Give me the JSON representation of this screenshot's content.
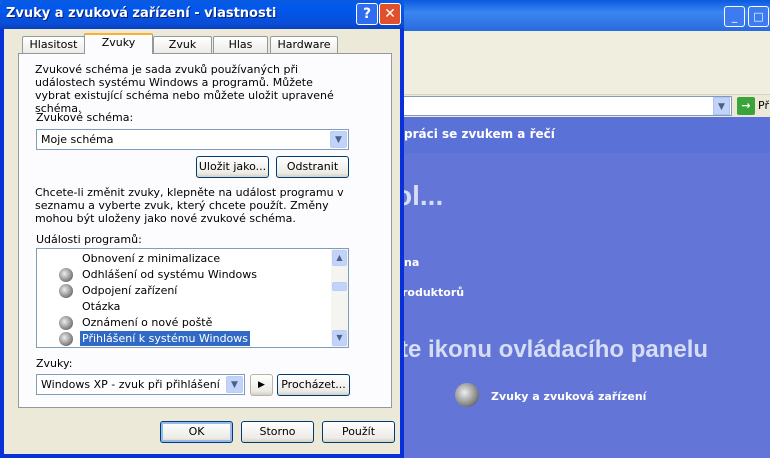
{
  "background_window": {
    "address_go_label": "Př",
    "header_text": "práci se zvukem a řečí",
    "heading_partial": "ol...",
    "link1_partial": "na",
    "link2_partial": "roduktorů",
    "pick_icon_heading": "te ikonu ovládacího panelu",
    "control_panel_icon_label": "Zvuky a zvuková zařízení"
  },
  "dialog": {
    "title": "Zvuky a zvuková zařízení - vlastnosti",
    "help_label": "?",
    "close_label": "✕",
    "tabs": [
      {
        "label": "Hlasitost"
      },
      {
        "label": "Zvuky",
        "selected": true
      },
      {
        "label": "Zvuk"
      },
      {
        "label": "Hlas"
      },
      {
        "label": "Hardware"
      }
    ],
    "scheme_description": "Zvukové schéma je sada zvuků používaných při událostech systému Windows a programů. Můžete vybrat existující schéma nebo můžete uložit upravené schéma.",
    "scheme_label": "Zvukové schéma:",
    "scheme_value": "Moje schéma",
    "save_as_label": "Uložit jako...",
    "delete_label": "Odstranit",
    "events_description": "Chcete-li změnit zvuky, klepněte na událost programu v seznamu a vyberte zvuk, který chcete použít. Změny mohou být uloženy jako nové zvukové schéma.",
    "events_label": "Události programů:",
    "events": [
      {
        "label": "Obnovení z minimalizace",
        "has_sound": false
      },
      {
        "label": "Odhlášení od systému Windows",
        "has_sound": true
      },
      {
        "label": "Odpojení zařízení",
        "has_sound": true
      },
      {
        "label": "Otázka",
        "has_sound": false
      },
      {
        "label": "Oznámení o nové poště",
        "has_sound": true
      },
      {
        "label": "Přihlášení k systému Windows",
        "has_sound": true,
        "selected": true
      }
    ],
    "sounds_label": "Zvuky:",
    "sound_value": "Windows XP - zvuk při přihlášení",
    "browse_label": "Procházet...",
    "ok_label": "OK",
    "cancel_label": "Storno",
    "apply_label": "Použít"
  }
}
